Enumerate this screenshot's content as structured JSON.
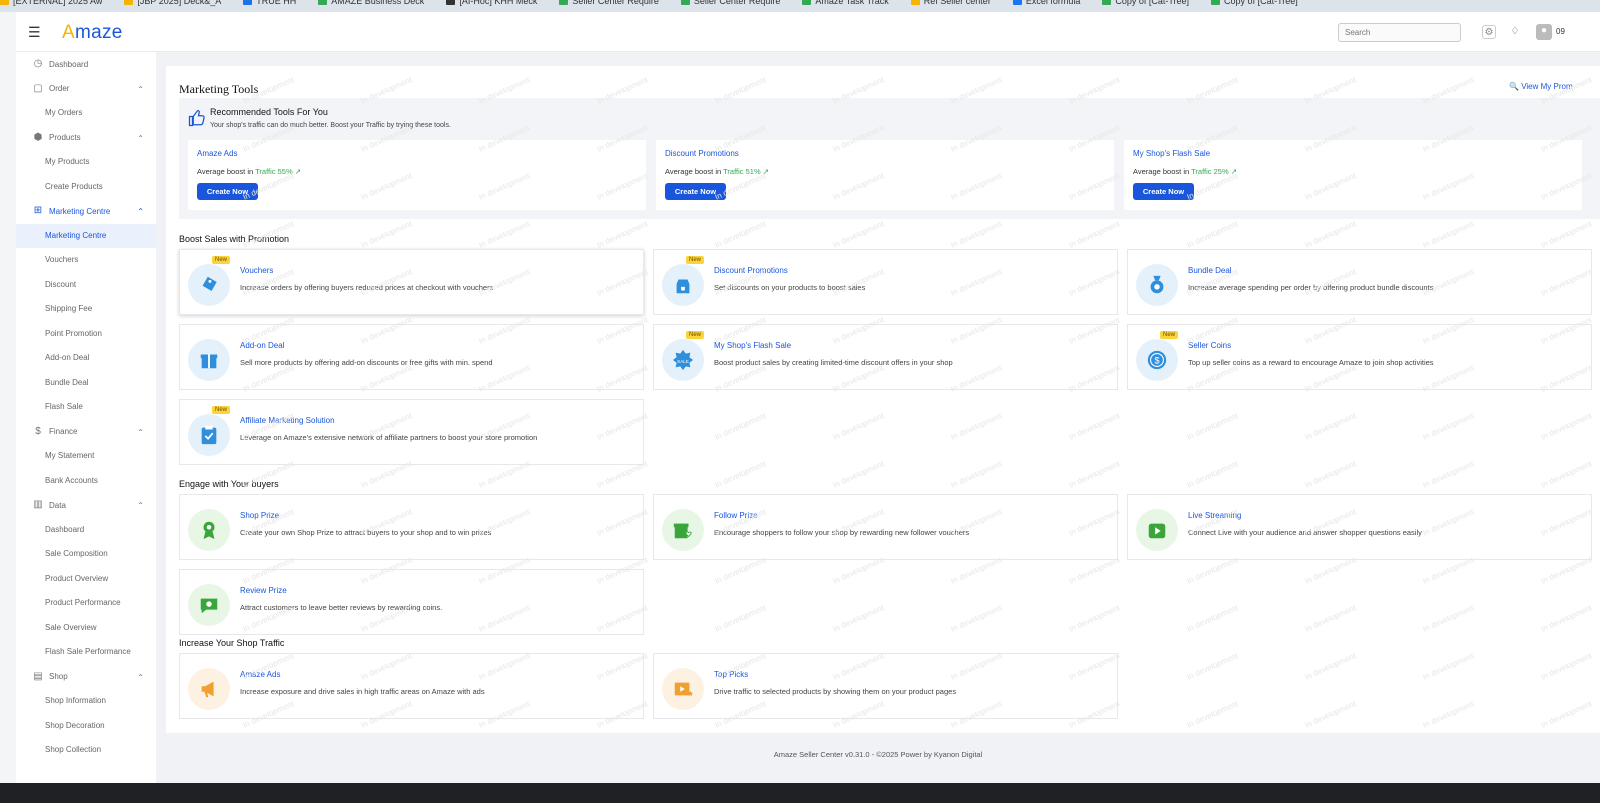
{
  "bookmarks": [
    {
      "label": "[EXTERNAL] 2025 Aw",
      "color": "#f4b400"
    },
    {
      "label": "[JBP 2025] Deck&_A",
      "color": "#f4b400"
    },
    {
      "label": "TRUE HH",
      "color": "#1a73e8"
    },
    {
      "label": "AMAZE Business Deck",
      "color": "#34a853"
    },
    {
      "label": "[AI-Hoc] KHH Meck",
      "color": "#333333"
    },
    {
      "label": "Seller Center Require",
      "color": "#34a853"
    },
    {
      "label": "Seller Center Require",
      "color": "#34a853"
    },
    {
      "label": "Amaze Task Track",
      "color": "#34a853"
    },
    {
      "label": "Ref Seller center",
      "color": "#f4b400"
    },
    {
      "label": "Excel formula",
      "color": "#1877f2"
    },
    {
      "label": "Copy of [Cat-Tree]",
      "color": "#34a853"
    },
    {
      "label": "Copy of [Cat-Tree]",
      "color": "#34a853"
    }
  ],
  "header": {
    "logo": "Amaze",
    "search_placeholder": "Search",
    "avatar_text": "09"
  },
  "sidebar": [
    {
      "label": "Dashboard",
      "icon": "dashboard-icon",
      "glyph": "◷",
      "children": []
    },
    {
      "label": "Order",
      "icon": "order-icon",
      "glyph": "▢",
      "children": [
        "My Orders"
      ]
    },
    {
      "label": "Products",
      "icon": "products-icon",
      "glyph": "⬢",
      "children": [
        "My Products",
        "Create Products"
      ]
    },
    {
      "label": "Marketing Centre",
      "icon": "gift-icon",
      "glyph": "⊞",
      "active": true,
      "children": [
        "Marketing Centre",
        "Vouchers",
        "Discount",
        "Shipping Fee",
        "Point Promotion",
        "Add-on Deal",
        "Bundle Deal",
        "Flash Sale"
      ],
      "active_child": 0
    },
    {
      "label": "Finance",
      "icon": "finance-icon",
      "glyph": "$",
      "children": [
        "My Statement",
        "Bank Accounts"
      ]
    },
    {
      "label": "Data",
      "icon": "data-chart-icon",
      "glyph": "▥",
      "children": [
        "Dashboard",
        "Sale Composition",
        "Product Overview",
        "Product Performance",
        "Sale Overview",
        "Flash Sale Performance"
      ]
    },
    {
      "label": "Shop",
      "icon": "shop-icon",
      "glyph": "▤",
      "children": [
        "Shop Information",
        "Shop Decoration",
        "Shop Collection"
      ]
    }
  ],
  "main": {
    "title": "Marketing Tools",
    "view_promotions": "View My Prom",
    "recommended": {
      "title": "Recommended Tools For You",
      "subtitle": "Your shop's traffic can do much better. Boost your Traffic by trying these tools.",
      "cards": [
        {
          "name": "Amaze Ads",
          "prefix": "Average boost in ",
          "traffic": "Traffic 55%",
          "button": "Create Now"
        },
        {
          "name": "Discount Promotions",
          "prefix": "Average boost in ",
          "traffic": "Traffic 51%",
          "button": "Create Now"
        },
        {
          "name": "My Shop's Flash Sale",
          "prefix": "Average boost in ",
          "traffic": "Traffic 25%",
          "button": "Create Now"
        }
      ]
    },
    "sections": [
      {
        "title": "Boost Sales with Promotion",
        "cards": [
          {
            "title": "Vouchers",
            "desc": "Increase orders by offering buyers reduced prices at checkout with vouchers",
            "badge": "New",
            "icon": "voucher-tag-icon",
            "bg": "#e4f1fb",
            "color": "#2f8fdc"
          },
          {
            "title": "Discount Promotions",
            "desc": "Set discounts on your products to boost sales",
            "badge": "New",
            "icon": "discount-tag-icon",
            "bg": "#e4f1fb",
            "color": "#2f8fdc"
          },
          {
            "title": "Bundle Deal",
            "desc": "Increase average spending per order by offering product bundle discounts",
            "badge": "",
            "icon": "bundle-medal-icon",
            "bg": "#e4f1fb",
            "color": "#2f8fdc"
          },
          {
            "title": "Add-on Deal",
            "desc": "Sell more products by offering add-on discounts or free gifts with min. spend",
            "badge": "",
            "icon": "gift-box-icon",
            "bg": "#e4f1fb",
            "color": "#2f8fdc"
          },
          {
            "title": "My Shop's Flash Sale",
            "desc": "Boost product sales by creating limited-time discount offers in your shop",
            "badge": "New",
            "icon": "sale-burst-icon",
            "bg": "#e4f1fb",
            "color": "#2f8fdc"
          },
          {
            "title": "Seller Coins",
            "desc": "Top up seller coins as a reward to encourage Amaze to join shop activities",
            "badge": "New",
            "icon": "coin-icon",
            "bg": "#e4f1fb",
            "color": "#2f8fdc"
          },
          {
            "title": "Affiliate Marketing Solution",
            "desc": "Leverage on Amaze's extensive network of affiliate partners to boost your store promotion",
            "badge": "New",
            "icon": "clipboard-check-icon",
            "bg": "#e4f1fb",
            "color": "#2f8fdc"
          }
        ]
      },
      {
        "title": "Engage with Your buyers",
        "cards": [
          {
            "title": "Shop Prize",
            "desc": "Create your own Shop Prize to attract buyers to your shop and to win prizes",
            "badge": "",
            "icon": "prize-ribbon-icon",
            "bg": "#e8f6e6",
            "color": "#3aa53a"
          },
          {
            "title": "Follow Prize",
            "desc": "Encourage shoppers to follow your shop by rewarding new follower vouchers",
            "badge": "",
            "icon": "follow-gift-icon",
            "bg": "#e8f6e6",
            "color": "#3aa53a"
          },
          {
            "title": "Live Streaming",
            "desc": "Connect Live with your audience and answer shopper questions easily",
            "badge": "",
            "icon": "live-play-icon",
            "bg": "#e8f6e6",
            "color": "#3aa53a"
          },
          {
            "title": "Review Prize",
            "desc": "Attract customers to leave better reviews by rewarding coins.",
            "badge": "",
            "icon": "review-chat-icon",
            "bg": "#e8f6e6",
            "color": "#3aa53a"
          }
        ]
      },
      {
        "title": "Increase Your Shop Traffic",
        "cards": [
          {
            "title": "Amaze Ads",
            "desc": "Increase exposure and drive sales in high traffic areas on Amaze with ads",
            "badge": "",
            "icon": "megaphone-icon",
            "bg": "#fdf1e2",
            "color": "#f0a030"
          },
          {
            "title": "Top Picks",
            "desc": "Drive traffic to selected products by showing them on your product pages",
            "badge": "",
            "icon": "top-picks-icon",
            "bg": "#fdf1e2",
            "color": "#f0a030"
          }
        ]
      }
    ]
  },
  "watermark": "In development",
  "footer": "Amaze Seller Center v0.31.0 - ©2025 Power by Kyanon Digital"
}
